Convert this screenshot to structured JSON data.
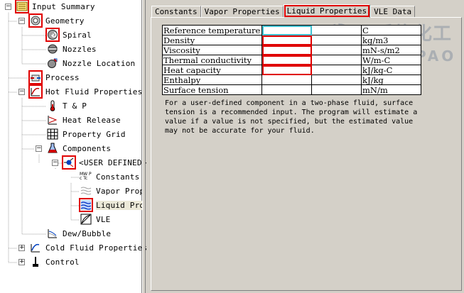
{
  "tree": {
    "root": "Input Summary",
    "geometry": "Geometry",
    "spiral": "Spiral",
    "nozzles": "Nozzles",
    "nozzle_location": "Nozzle Location",
    "process": "Process",
    "hot_fluid": "Hot Fluid Properties",
    "tp": "T & P",
    "heat_release": "Heat Release",
    "property_grid": "Property Grid",
    "components": "Components",
    "user_defined": "<USER DEFINED>",
    "constants": "Constants",
    "vapor_prop": "Vapor Prop",
    "liquid_pro": "Liquid Pro",
    "vle": "VLE",
    "dew_bubble": "Dew/Bubble",
    "cold_fluid": "Cold Fluid Properties",
    "control": "Control",
    "constants_icon_text": "MW Pc Tc"
  },
  "tabs": [
    "Constants",
    "Vapor Properties",
    "Liquid Properties",
    "VLE Data"
  ],
  "active_tab": 2,
  "properties": [
    {
      "name": "Reference temperature",
      "unit": "C"
    },
    {
      "name": "Density",
      "unit": "kg/m3"
    },
    {
      "name": "Viscosity",
      "unit": "mN-s/m2"
    },
    {
      "name": "Thermal conductivity",
      "unit": "W/m-C"
    },
    {
      "name": "Heat capacity",
      "unit": "kJ/kg-C"
    },
    {
      "name": "Enthalpy",
      "unit": "kJ/kg"
    },
    {
      "name": "Surface tension",
      "unit": "mN/m"
    }
  ],
  "note": "For a user-defined component in a two-phase fluid, surface\ntension is a recommended input. The program will estimate a\nvalue if a value is not specified, but the estimated value\nmay not be accurate for your fluid.",
  "watermark": {
    "cn": "马后炮化工",
    "en": "HOUPAO"
  }
}
